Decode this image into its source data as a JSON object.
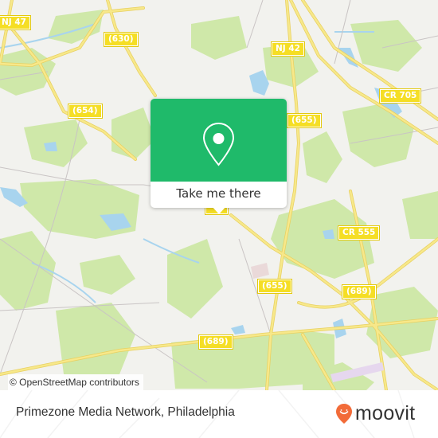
{
  "map": {
    "road_labels": [
      {
        "id": "nj-47",
        "text": "NJ 47"
      },
      {
        "id": "630",
        "text": "(630)"
      },
      {
        "id": "nj-42",
        "text": "NJ 42"
      },
      {
        "id": "654",
        "text": "(654)"
      },
      {
        "id": "655-north",
        "text": "(655)"
      },
      {
        "id": "cr-705",
        "text": "CR 705"
      },
      {
        "id": "cr-555",
        "text": "CR 555"
      },
      {
        "id": "655-south",
        "text": "(655)"
      },
      {
        "id": "689-east",
        "text": "(689)"
      },
      {
        "id": "689-south",
        "text": "(689)"
      }
    ],
    "colors": {
      "land": "#f2f2ee",
      "park": "#cfe8a9",
      "water": "#a8d4ee",
      "road_major": "#f6e27a",
      "road_minor": "#c9c4c4",
      "shield": "#f5de25"
    }
  },
  "popup": {
    "icon": "map-pin-icon",
    "button_label": "Take me there",
    "accent": "#1fba6a"
  },
  "attribution": "© OpenStreetMap contributors",
  "footer": {
    "place_name": "Primezone Media Network, Philadelphia",
    "brand": {
      "name": "moovit",
      "icon": "moovit-pin-icon",
      "color": "#f26b38"
    }
  }
}
